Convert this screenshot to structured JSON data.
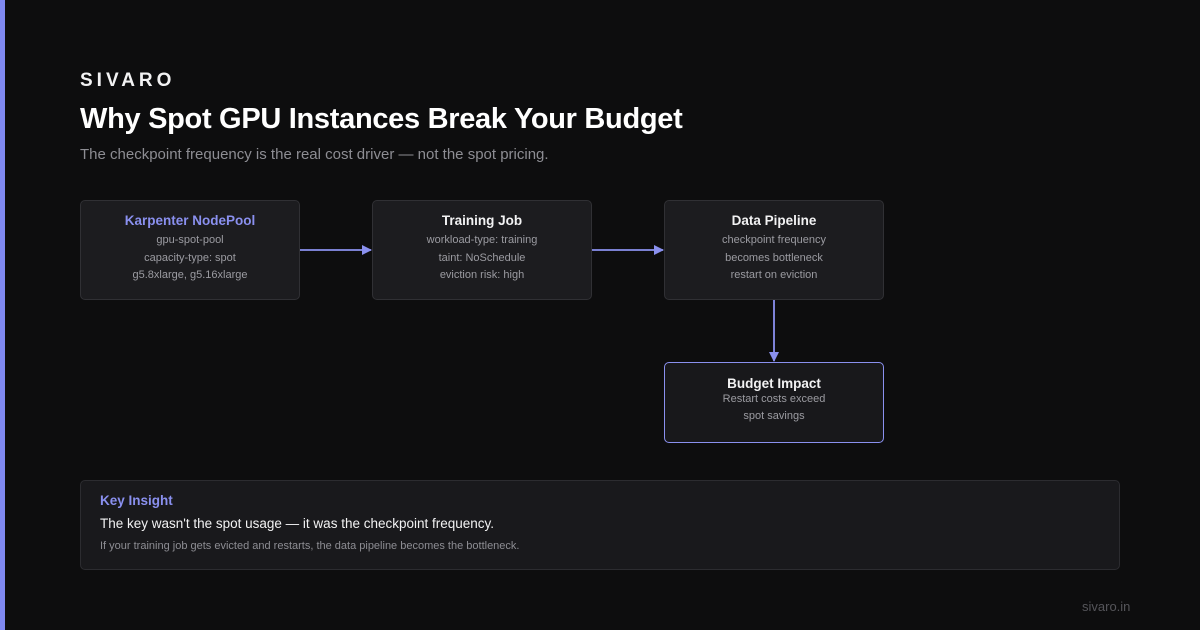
{
  "brand": "SIVARO",
  "title": "Why Spot GPU Instances Break Your Budget",
  "subtitle": "The checkpoint frequency is the real cost driver — not the spot pricing.",
  "nodes": {
    "nodepool": {
      "title": "Karpenter NodePool",
      "sub": "gpu-spot-pool",
      "lines": [
        "capacity-type: spot",
        "g5.8xlarge, g5.16xlarge"
      ]
    },
    "training": {
      "title": "Training Job",
      "sub": "workload-type: training",
      "lines": [
        "taint: NoSchedule",
        "eviction risk: high"
      ]
    },
    "pipeline": {
      "title": "Data Pipeline",
      "sub": "checkpoint frequency",
      "lines": [
        "becomes bottleneck",
        "restart on eviction"
      ]
    },
    "budget": {
      "title": "Budget Impact",
      "lines": [
        "Restart costs exceed",
        "spot savings"
      ]
    }
  },
  "insight": {
    "label": "Key Insight",
    "main": "The key wasn't the spot usage — it was the checkpoint frequency.",
    "note": "If your training job gets evicted and restarts, the data pipeline becomes the bottleneck."
  },
  "footer": "sivaro.in",
  "colors": {
    "accent": "#8a90ef",
    "background": "#0d0d0e",
    "node_fill": "#1c1c1f",
    "node_border": "#303034"
  }
}
